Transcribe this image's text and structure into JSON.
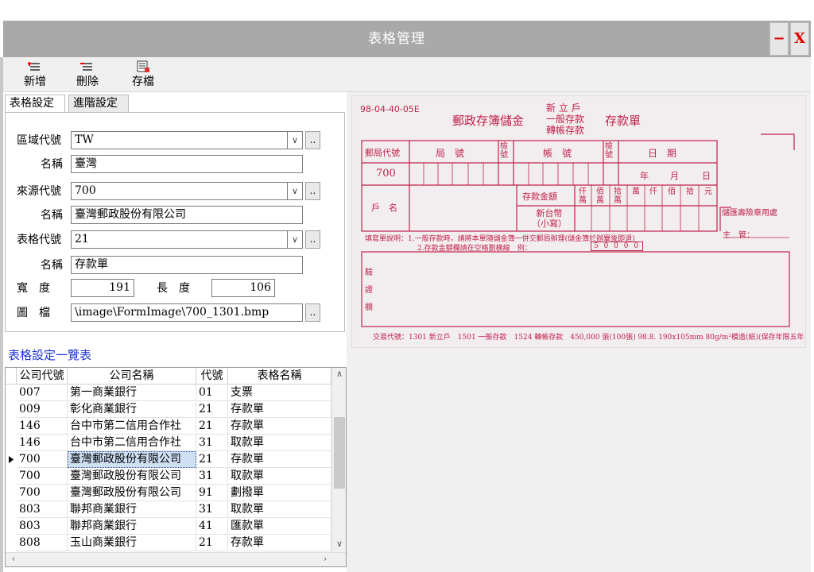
{
  "window": {
    "title": "表格管理",
    "minimize_label": "−",
    "close_label": "X"
  },
  "toolbar": {
    "add": {
      "label": "新增",
      "icon": "add-icon"
    },
    "delete": {
      "label": "刪除",
      "icon": "delete-icon"
    },
    "save": {
      "label": "存檔",
      "icon": "save-icon"
    }
  },
  "tabs": [
    {
      "label": "表格設定"
    },
    {
      "label": "進階設定"
    }
  ],
  "form": {
    "region_code_label": "區域代號",
    "region_code": "TW",
    "region_name_label": "名稱",
    "region_name": "臺灣",
    "source_code_label": "來源代號",
    "source_code": "700",
    "source_name_label": "名稱",
    "source_name": "臺灣郵政股份有限公司",
    "form_code_label": "表格代號",
    "form_code": "21",
    "form_name_label": "名稱",
    "form_name": "存款單",
    "width_label": "寬　度",
    "width": "191",
    "length_label": "長　度",
    "length": "106",
    "image_label": "圖　檔",
    "image_path": "\\image\\FormImage\\700_1301.bmp",
    "browse_label": ".."
  },
  "list": {
    "title": "表格設定一覽表",
    "columns": [
      "公司代號",
      "公司名稱",
      "代號",
      "表格名稱"
    ],
    "rows": [
      [
        "007",
        "第一商業銀行",
        "01",
        "支票"
      ],
      [
        "009",
        "彰化商業銀行",
        "21",
        "存款單"
      ],
      [
        "146",
        "台中市第二信用合作社",
        "21",
        "存款單"
      ],
      [
        "146",
        "台中市第二信用合作社",
        "31",
        "取款單"
      ],
      [
        "700",
        "臺灣郵政股份有限公司",
        "21",
        "存款單"
      ],
      [
        "700",
        "臺灣郵政股份有限公司",
        "31",
        "取款單"
      ],
      [
        "700",
        "臺灣郵政股份有限公司",
        "91",
        "劃撥單"
      ],
      [
        "803",
        "聯邦商業銀行",
        "31",
        "取款單"
      ],
      [
        "803",
        "聯邦商業銀行",
        "41",
        "匯款單"
      ],
      [
        "808",
        "玉山商業銀行",
        "21",
        "存款單"
      ]
    ],
    "selected_row": 4
  },
  "preview": {
    "code": "98-04-40-05E",
    "header": "郵政存簿儲金",
    "types": [
      "新 立 戶",
      "一般存款",
      "轉帳存款"
    ],
    "form_title": "存款單",
    "office_code_label": "郵局代號",
    "office_label": "局　號",
    "check_label": "檢號",
    "account_label": "帳　號",
    "date_label": "日　期",
    "office_value": "700",
    "year_label": "年",
    "month_label": "月",
    "day_label": "日",
    "name_label": "戶　名",
    "amount_label": "存款金額",
    "currency_label": "新台幣",
    "currency_sub": "（小寫）",
    "digit_labels": [
      "仟萬",
      "佰萬",
      "拾萬",
      "萬",
      "仟",
      "佰",
      "拾",
      "元"
    ],
    "side_note": "儲匯壽險章用處",
    "supervisor_label": "主　管：",
    "instructions": "填寫單說明：1.一般存款時，請將本單隨儲金簿一併交郵局辦理(儲金簿於辦畢後即退)",
    "instructions2": "2.存款金額欄請在空格劃橫線　例：",
    "example_amount": "5 0 0 0 0",
    "verify_labels": [
      "驗",
      "證",
      "欄"
    ],
    "footer": "交易代號：1301 新立戶　1501 一般存款　1524 轉帳存款　450,000 張(100張) 98.8. 190x105mm 80g/m²模造(紙)(保存年限五年"
  },
  "colors": {
    "titlebar": "#a9a9a9",
    "form_red": "#c2214b",
    "list_title": "#1d31d6"
  }
}
